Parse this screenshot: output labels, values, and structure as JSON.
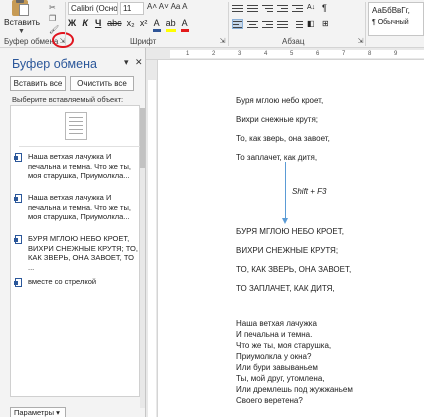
{
  "ribbon": {
    "paste_label": "Вставить",
    "font_name": "Calibri (Осно",
    "font_size": "11",
    "grow_font": "A˄ A˅",
    "change_case": "Aa",
    "clear_format": "A",
    "bold": "Ж",
    "italic": "К",
    "underline": "Ч",
    "strike": "abc",
    "subscript": "x₂",
    "superscript": "x²",
    "text_effects": "A",
    "highlight": "ab",
    "font_color": "A",
    "groups": {
      "clipboard": "Буфер обмена",
      "font": "Шрифт",
      "paragraph": "Абзац"
    },
    "styles": {
      "sample": "АаБбВвГг,",
      "name": "¶ Обычный"
    },
    "pilcrow": "¶"
  },
  "clipboard_pane": {
    "title": "Буфер обмена",
    "paste_all": "Вставить все",
    "clear_all": "Очистить все",
    "prompt": "Выберите вставляемый объект:",
    "items": [
      {
        "type": "image",
        "text": ""
      },
      {
        "type": "text",
        "text": "Наша ветхая лачужка И печальна и темна. Что же ты, моя старушка, Приумолкла..."
      },
      {
        "type": "text",
        "text": "Наша ветхая лачужка И печальна и темна. Что же ты, моя старушка, Приумолкла..."
      },
      {
        "type": "text",
        "text": "БУРЯ МГЛОЮ НЕБО КРОЕТ, ВИХРИ СНЕЖНЫЕ КРУТЯ; ТО, КАК ЗВЕРЬ, ОНА ЗАВОЕТ, ТО ..."
      },
      {
        "type": "text",
        "text": "вместе со стрелкой"
      }
    ],
    "options_button": "Параметры ▾",
    "close_glyph": "✕",
    "menu_glyph": "▾"
  },
  "document": {
    "stanza1": [
      "Буря мглою небо кроет,",
      "Вихри снежные крутя;",
      "То, как зверь, она завоет,",
      "То заплачет, как дитя,"
    ],
    "annotation": "Shift + F3",
    "stanza2": [
      "БУРЯ МГЛОЮ НЕБО КРОЕТ,",
      "ВИХРИ СНЕЖНЫЕ КРУТЯ;",
      "ТО, КАК ЗВЕРЬ, ОНА ЗАВОЕТ,",
      "ТО ЗАПЛАЧЕТ, КАК ДИТЯ,"
    ],
    "stanza3": [
      "Наша ветхая лачужка",
      "И печальна и темна.",
      "Что же ты, моя старушка,",
      "Приумолкла у окна?",
      "Или бури завываньем",
      "Ты, мой друг, утомлена,",
      "Или дремлешь под жужжаньем",
      "Своего веретена?"
    ]
  },
  "ruler": {
    "ticks": [
      "1",
      "2",
      "3",
      "4",
      "5",
      "6",
      "7",
      "8",
      "9"
    ]
  },
  "colors": {
    "accent": "#2b579a",
    "highlight_circle": "#e0141e",
    "arrow": "#5b9bd5"
  }
}
